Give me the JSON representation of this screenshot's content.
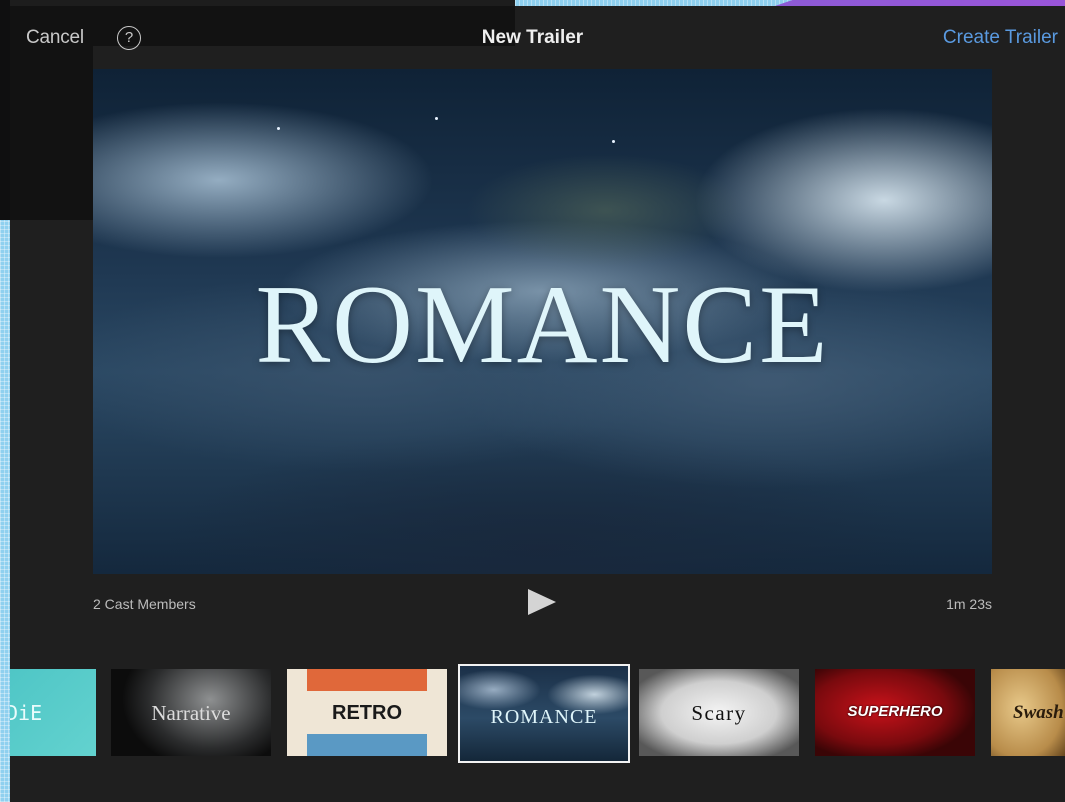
{
  "nav": {
    "cancel_label": "Cancel",
    "help_icon": "?",
    "title": "New Trailer",
    "create_label": "Create Trailer"
  },
  "preview": {
    "title_text": "ROMANCE",
    "cast_members": "2 Cast Members",
    "duration": "1m 23s"
  },
  "themes": [
    {
      "label": "DiE",
      "selected": false
    },
    {
      "label": "Narrative",
      "selected": false
    },
    {
      "label": "RETRO",
      "selected": false
    },
    {
      "label": "ROMANCE",
      "selected": true
    },
    {
      "label": "Scary",
      "selected": false
    },
    {
      "label": "SUPERHERO",
      "selected": false
    },
    {
      "label": "Swash",
      "selected": false
    }
  ],
  "colors": {
    "accent": "#5a9ae0",
    "background": "#1f1f1f"
  }
}
